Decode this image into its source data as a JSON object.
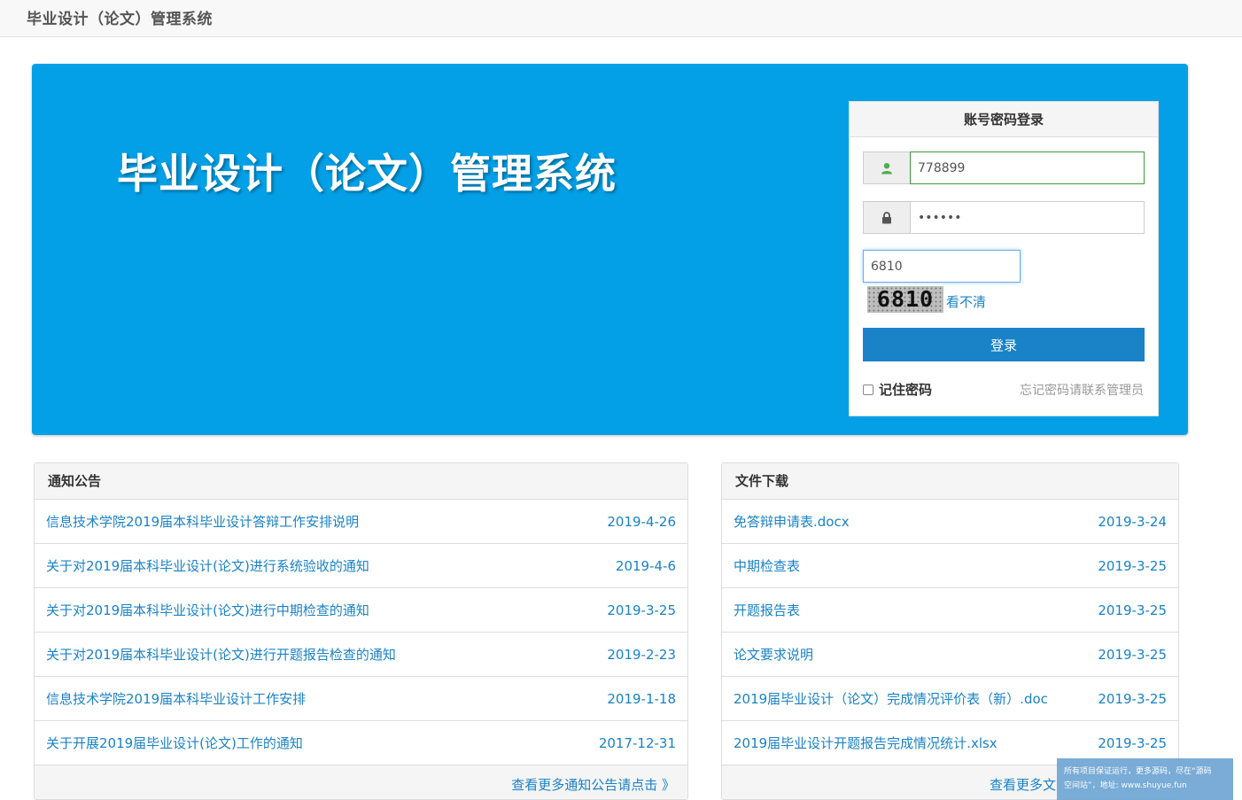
{
  "topbar": {
    "brand": "毕业设计（论文）管理系统"
  },
  "hero": {
    "title": "毕业设计（论文）管理系统"
  },
  "login": {
    "heading": "账号密码登录",
    "username_value": "778899",
    "password_value": "••••••",
    "captcha_input_value": "6810",
    "captcha_text": "6810",
    "captcha_refresh_label": "看不清",
    "submit_label": "登录",
    "remember_label": "记住密码",
    "forgot_text": "忘记密码请联系管理员",
    "user_icon": "user-icon",
    "lock_icon": "lock-icon"
  },
  "notice": {
    "heading": "通知公告",
    "items": [
      {
        "title": "信息技术学院2019届本科毕业设计答辩工作安排说明",
        "date": "2019-4-26"
      },
      {
        "title": "关于对2019届本科毕业设计(论文)进行系统验收的通知",
        "date": "2019-4-6"
      },
      {
        "title": "关于对2019届本科毕业设计(论文)进行中期检查的通知",
        "date": "2019-3-25"
      },
      {
        "title": "关于对2019届本科毕业设计(论文)进行开题报告检查的通知",
        "date": "2019-2-23"
      },
      {
        "title": "信息技术学院2019届本科毕业设计工作安排",
        "date": "2019-1-18"
      },
      {
        "title": "关于开展2019届毕业设计(论文)工作的通知",
        "date": "2017-12-31"
      }
    ],
    "more_label": "查看更多通知公告请点击 》"
  },
  "files": {
    "heading": "文件下载",
    "items": [
      {
        "title": "免答辩申请表.docx",
        "date": "2019-3-24"
      },
      {
        "title": "中期检查表",
        "date": "2019-3-25"
      },
      {
        "title": "开题报告表",
        "date": "2019-3-25"
      },
      {
        "title": "论文要求说明",
        "date": "2019-3-25"
      },
      {
        "title": "2019届毕业设计（论文）完成情况评价表（新）.doc",
        "date": "2019-3-25"
      },
      {
        "title": "2019届毕业设计开题报告完成情况统计.xlsx",
        "date": "2019-3-25"
      }
    ],
    "more_label": "查看更多文"
  },
  "watermark": {
    "line1": "所有项目保证运行，更多源码，尽在“源码",
    "line2": "空间站”，地址: www.shuyue.fun"
  },
  "colors": {
    "hero_blue": "#03a0e7",
    "link_blue": "#1a82c6",
    "button_blue": "#1a82c6"
  }
}
